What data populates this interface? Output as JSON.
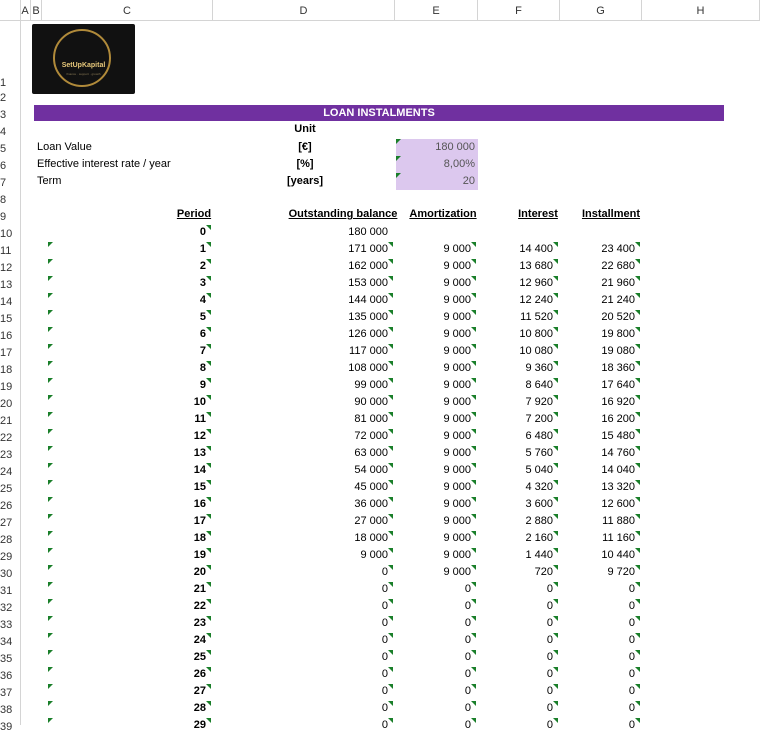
{
  "columns": [
    "A",
    "B",
    "C",
    "D",
    "E",
    "F",
    "G",
    "H"
  ],
  "rows": [
    "1",
    "2",
    "3",
    "4",
    "5",
    "6",
    "7",
    "8",
    "9",
    "10",
    "11",
    "12",
    "13",
    "14",
    "15",
    "16",
    "17",
    "18",
    "19",
    "20",
    "21",
    "22",
    "23",
    "24",
    "25",
    "26",
    "27",
    "28",
    "29",
    "30",
    "31",
    "32",
    "33",
    "34",
    "35",
    "36",
    "37",
    "38",
    "39"
  ],
  "logo": {
    "brand": "SetUpKapital",
    "tagline": "finance · support · growth"
  },
  "title": "LOAN INSTALMENTS",
  "unit_header": "Unit",
  "inputs": [
    {
      "label": "Loan Value",
      "unit": "[€]",
      "value": "180 000"
    },
    {
      "label": "Effective interest rate / year",
      "unit": "[%]",
      "value": "8,00%"
    },
    {
      "label": "Term",
      "unit": "[years]",
      "value": "20"
    }
  ],
  "table_headers": {
    "period": "Period",
    "balance": "Outstanding balance",
    "amortization": "Amortization",
    "interest": "Interest",
    "installment": "Installment"
  },
  "schedule": [
    {
      "period": "0",
      "balance": "180 000",
      "amortization": "",
      "interest": "",
      "installment": ""
    },
    {
      "period": "1",
      "balance": "171 000",
      "amortization": "9 000",
      "interest": "14 400",
      "installment": "23 400"
    },
    {
      "period": "2",
      "balance": "162 000",
      "amortization": "9 000",
      "interest": "13 680",
      "installment": "22 680"
    },
    {
      "period": "3",
      "balance": "153 000",
      "amortization": "9 000",
      "interest": "12 960",
      "installment": "21 960"
    },
    {
      "period": "4",
      "balance": "144 000",
      "amortization": "9 000",
      "interest": "12 240",
      "installment": "21 240"
    },
    {
      "period": "5",
      "balance": "135 000",
      "amortization": "9 000",
      "interest": "11 520",
      "installment": "20 520"
    },
    {
      "period": "6",
      "balance": "126 000",
      "amortization": "9 000",
      "interest": "10 800",
      "installment": "19 800"
    },
    {
      "period": "7",
      "balance": "117 000",
      "amortization": "9 000",
      "interest": "10 080",
      "installment": "19 080"
    },
    {
      "period": "8",
      "balance": "108 000",
      "amortization": "9 000",
      "interest": "9 360",
      "installment": "18 360"
    },
    {
      "period": "9",
      "balance": "99 000",
      "amortization": "9 000",
      "interest": "8 640",
      "installment": "17 640"
    },
    {
      "period": "10",
      "balance": "90 000",
      "amortization": "9 000",
      "interest": "7 920",
      "installment": "16 920"
    },
    {
      "period": "11",
      "balance": "81 000",
      "amortization": "9 000",
      "interest": "7 200",
      "installment": "16 200"
    },
    {
      "period": "12",
      "balance": "72 000",
      "amortization": "9 000",
      "interest": "6 480",
      "installment": "15 480"
    },
    {
      "period": "13",
      "balance": "63 000",
      "amortization": "9 000",
      "interest": "5 760",
      "installment": "14 760"
    },
    {
      "period": "14",
      "balance": "54 000",
      "amortization": "9 000",
      "interest": "5 040",
      "installment": "14 040"
    },
    {
      "period": "15",
      "balance": "45 000",
      "amortization": "9 000",
      "interest": "4 320",
      "installment": "13 320"
    },
    {
      "period": "16",
      "balance": "36 000",
      "amortization": "9 000",
      "interest": "3 600",
      "installment": "12 600"
    },
    {
      "period": "17",
      "balance": "27 000",
      "amortization": "9 000",
      "interest": "2 880",
      "installment": "11 880"
    },
    {
      "period": "18",
      "balance": "18 000",
      "amortization": "9 000",
      "interest": "2 160",
      "installment": "11 160"
    },
    {
      "period": "19",
      "balance": "9 000",
      "amortization": "9 000",
      "interest": "1 440",
      "installment": "10 440"
    },
    {
      "period": "20",
      "balance": "0",
      "amortization": "9 000",
      "interest": "720",
      "installment": "9 720"
    },
    {
      "period": "21",
      "balance": "0",
      "amortization": "0",
      "interest": "0",
      "installment": "0"
    },
    {
      "period": "22",
      "balance": "0",
      "amortization": "0",
      "interest": "0",
      "installment": "0"
    },
    {
      "period": "23",
      "balance": "0",
      "amortization": "0",
      "interest": "0",
      "installment": "0"
    },
    {
      "period": "24",
      "balance": "0",
      "amortization": "0",
      "interest": "0",
      "installment": "0"
    },
    {
      "period": "25",
      "balance": "0",
      "amortization": "0",
      "interest": "0",
      "installment": "0"
    },
    {
      "period": "26",
      "balance": "0",
      "amortization": "0",
      "interest": "0",
      "installment": "0"
    },
    {
      "period": "27",
      "balance": "0",
      "amortization": "0",
      "interest": "0",
      "installment": "0"
    },
    {
      "period": "28",
      "balance": "0",
      "amortization": "0",
      "interest": "0",
      "installment": "0"
    },
    {
      "period": "29",
      "balance": "0",
      "amortization": "0",
      "interest": "0",
      "installment": "0"
    }
  ],
  "colors": {
    "banner": "#7030a0",
    "input_fill": "#dcc8ee",
    "marker": "#1a7f2a"
  }
}
